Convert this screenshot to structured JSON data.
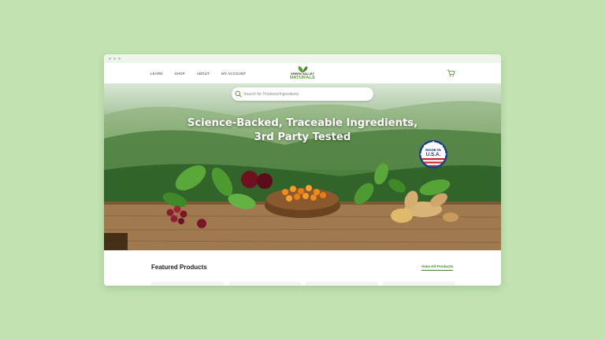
{
  "nav": {
    "links": [
      "LEARN",
      "SHOP",
      "ABOUT",
      "MY ACCOUNT"
    ],
    "logo_top": "GREEN VALLEY",
    "logo_bottom": "NATURALS"
  },
  "search": {
    "placeholder": "Search for Products/Ingredients"
  },
  "hero": {
    "headline_line1": "Science-Backed, Traceable Ingredients,",
    "headline_line2": "3rd Party Tested",
    "badge_line1": "MADE IN",
    "badge_line2": "U.S.A."
  },
  "featured": {
    "title": "Featured Products",
    "view_all": "View All Products"
  },
  "colors": {
    "page_bg": "#c2e2b2",
    "brand_green": "#5aa02c",
    "link_green": "#3f8a28"
  },
  "icons": [
    "search-icon",
    "cart-icon",
    "leaf-logo-icon"
  ]
}
